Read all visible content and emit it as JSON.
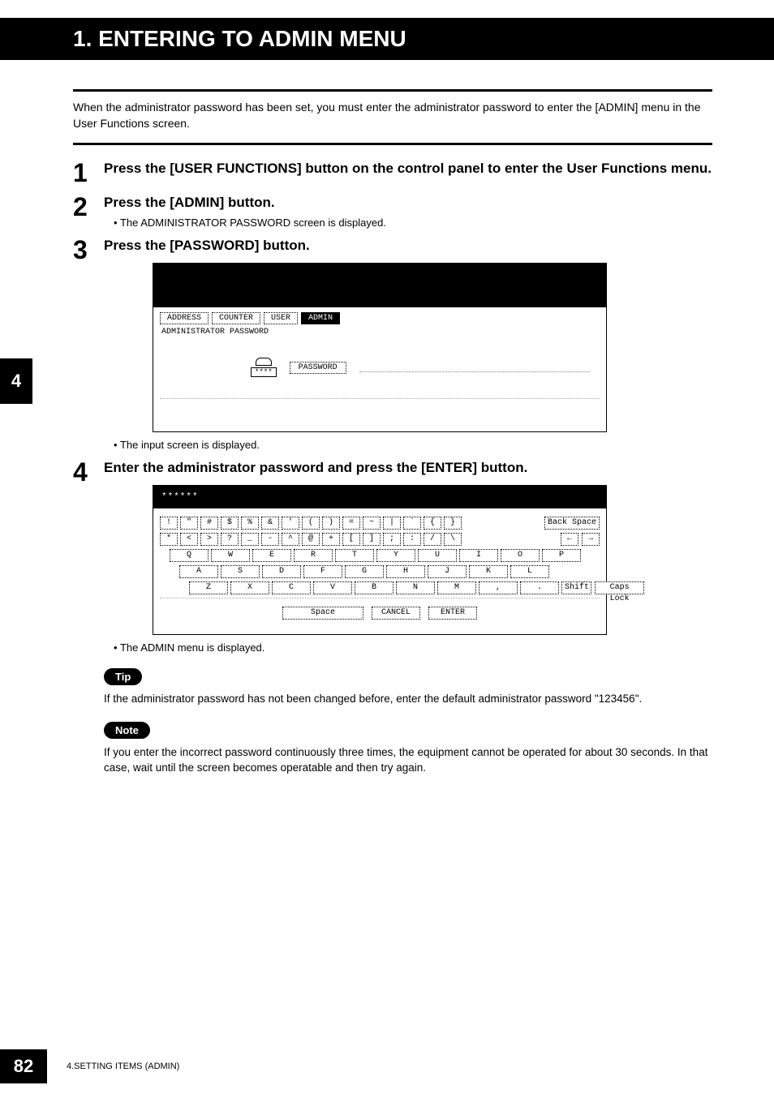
{
  "page": {
    "title": "1. ENTERING TO ADMIN MENU",
    "intro": "When the administrator password has been set, you must enter the administrator password to enter the [ADMIN] menu in the User Functions screen.",
    "side_tab": "4",
    "page_number": "82",
    "footer_section": "4.SETTING ITEMS (ADMIN)"
  },
  "steps": [
    {
      "num": "1",
      "title": "Press the [USER FUNCTIONS] button on the control panel to enter the User Functions menu."
    },
    {
      "num": "2",
      "title": "Press the [ADMIN] button.",
      "bullet": "The ADMINISTRATOR PASSWORD screen is displayed."
    },
    {
      "num": "3",
      "title": "Press the [PASSWORD] button.",
      "bullet_after": "The input screen is displayed."
    },
    {
      "num": "4",
      "title": "Enter the administrator password and press the [ENTER] button.",
      "bullet_after": "The ADMIN menu is displayed."
    }
  ],
  "screen1": {
    "tabs": [
      "ADDRESS",
      "COUNTER",
      "USER",
      "ADMIN"
    ],
    "selected_tab_index": 3,
    "label": "ADMINISTRATOR PASSWORD",
    "masked": "****",
    "password_btn": "PASSWORD"
  },
  "keyboard": {
    "display": "******",
    "row_sym1": [
      "!",
      "\"",
      "#",
      "$",
      "%",
      "&",
      "'",
      "(",
      ")",
      "=",
      "~",
      "|",
      "`",
      "{",
      "}"
    ],
    "row_sym2": [
      "*",
      "<",
      ">",
      "?",
      "_",
      "-",
      "^",
      "@",
      "+",
      "[",
      "]",
      ";",
      ":",
      "/",
      "\\"
    ],
    "row_q": [
      "Q",
      "W",
      "E",
      "R",
      "T",
      "Y",
      "U",
      "I",
      "O",
      "P"
    ],
    "row_a": [
      "A",
      "S",
      "D",
      "F",
      "G",
      "H",
      "J",
      "K",
      "L"
    ],
    "row_z": [
      "Z",
      "X",
      "C",
      "V",
      "B",
      "N",
      "M",
      ",",
      "."
    ],
    "backspace": "Back Space",
    "left": "←",
    "right": "→",
    "shift": "Shift",
    "caps": "Caps Lock",
    "space": "Space",
    "cancel": "CANCEL",
    "enter": "ENTER"
  },
  "tip": {
    "label": "Tip",
    "text": "If the administrator password has not been changed before, enter the default administrator password \"123456\"."
  },
  "note": {
    "label": "Note",
    "text": "If you enter the incorrect password continuously three times, the equipment cannot be operated for about 30 seconds.  In that case, wait until the screen becomes operatable and then try again."
  }
}
